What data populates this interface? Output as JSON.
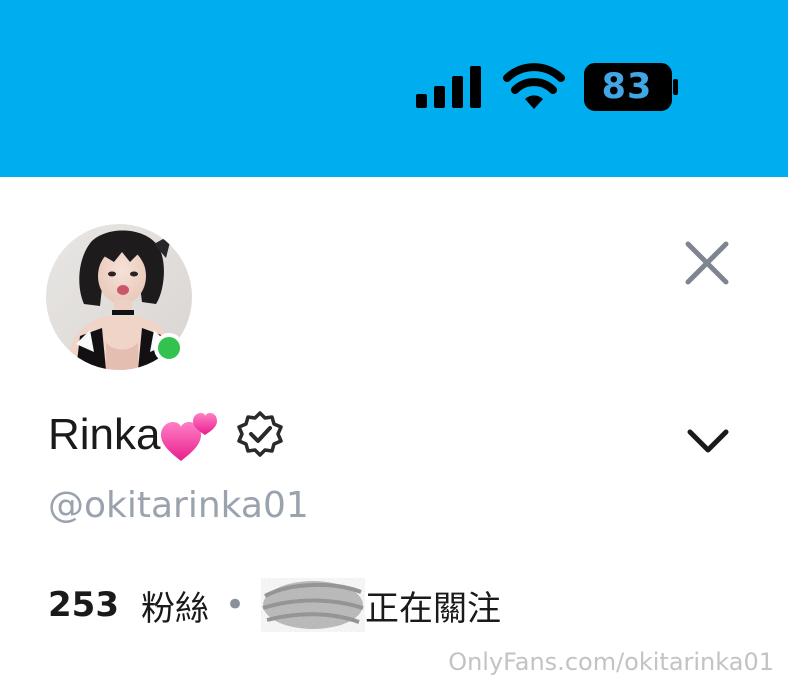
{
  "status_bar": {
    "battery_level": "83",
    "background_color": "#00aeef",
    "signal_icon": "signal-bars-icon",
    "wifi_icon": "wifi-icon"
  },
  "profile": {
    "display_name": "Rinka",
    "name_emoji": "two-hearts-icon",
    "verified_icon": "verified-badge-icon",
    "handle": "@okitarinka01",
    "online": true,
    "online_color": "#33c24d"
  },
  "stats": {
    "fans_count": "253",
    "fans_label": "粉絲",
    "separator": "•",
    "following_label": "正在關注"
  },
  "controls": {
    "close_icon": "close-icon",
    "expand_icon": "chevron-down-icon"
  },
  "watermark": "OnlyFans.com/okitarinka01"
}
